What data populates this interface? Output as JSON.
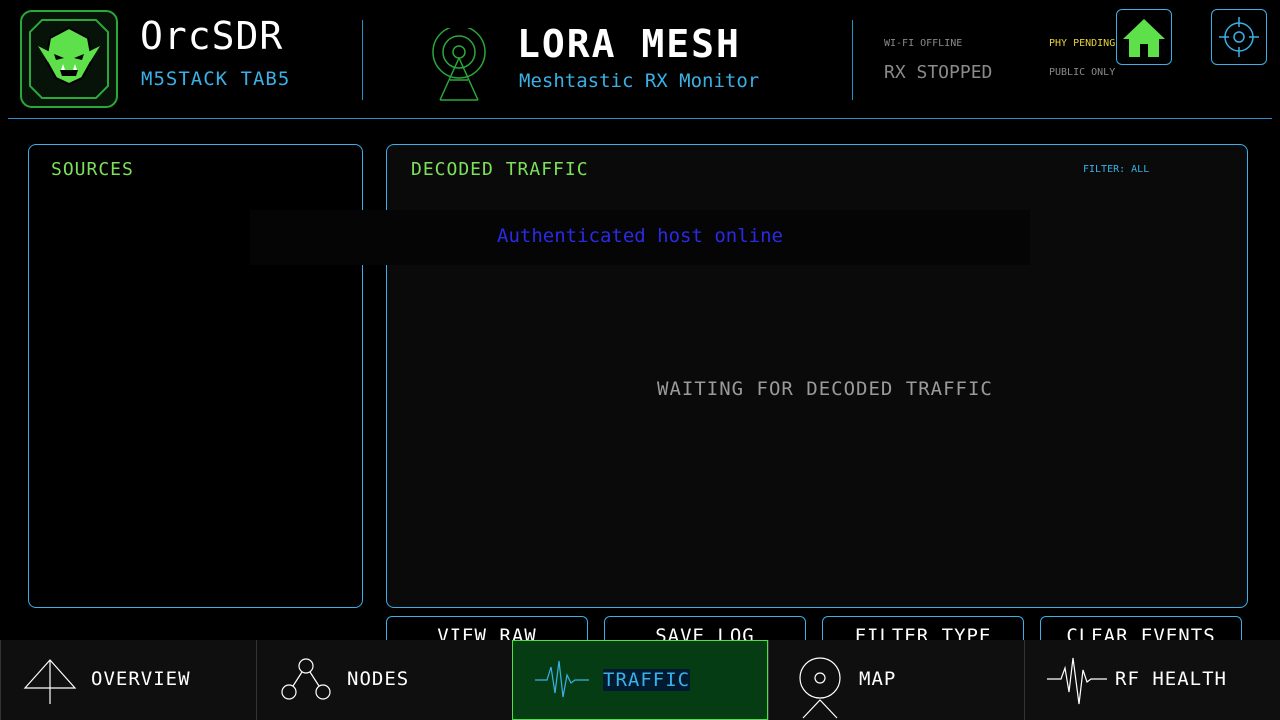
{
  "header": {
    "app_title": "OrcSDR",
    "app_subtitle": "M5STACK TAB5",
    "mode_title": "LORA MESH",
    "mode_subtitle": "Meshtastic RX Monitor",
    "status": {
      "wifi": "WI-FI OFFLINE",
      "rx": "RX STOPPED",
      "phy": "PHY PENDING",
      "scope": "PUBLIC ONLY"
    },
    "icons": [
      "orc-logo-icon",
      "antenna-tower-icon",
      "home-icon",
      "crosshair-icon"
    ]
  },
  "sources_panel": {
    "title": "SOURCES"
  },
  "traffic_panel": {
    "title": "DECODED TRAFFIC",
    "filter": "FILTER: ALL",
    "empty_message": "WAITING FOR DECODED TRAFFIC"
  },
  "toast": {
    "message": "Authenticated host online"
  },
  "actions": [
    "VIEW RAW",
    "SAVE LOG",
    "FILTER TYPE",
    "CLEAR EVENTS"
  ],
  "nav": {
    "items": [
      {
        "label": "OVERVIEW",
        "icon": "tower-icon"
      },
      {
        "label": "NODES",
        "icon": "nodes-icon"
      },
      {
        "label": "TRAFFIC",
        "icon": "waveform-icon"
      },
      {
        "label": "MAP",
        "icon": "map-pin-icon"
      },
      {
        "label": "RF HEALTH",
        "icon": "pulse-icon"
      }
    ],
    "active": "TRAFFIC"
  },
  "colors": {
    "accent_blue": "#3ab0e6",
    "accent_green": "#7de05a",
    "warning_yellow": "#e6d23a",
    "toast_text": "#2a2ae6",
    "nav_active_bg": "#063c14"
  }
}
